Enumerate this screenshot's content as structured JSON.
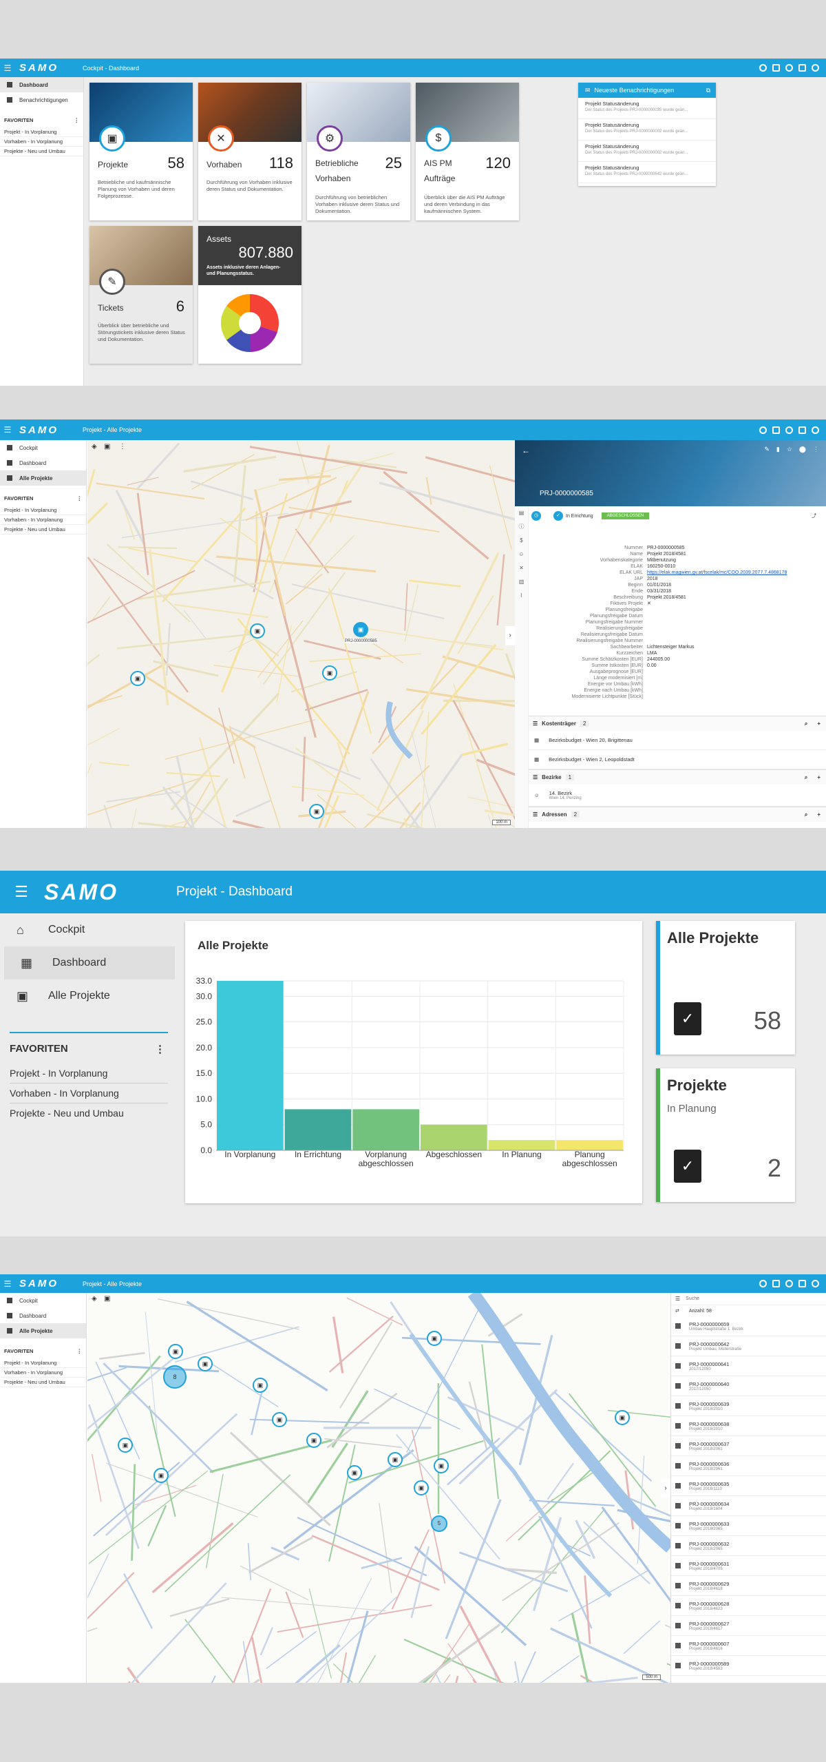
{
  "app": {
    "logo": "SAMO",
    "menu_icon": "menu-icon"
  },
  "s1": {
    "title": "Cockpit - Dashboard",
    "nav": [
      {
        "label": "Dashboard",
        "icon": "dashboard-icon"
      },
      {
        "label": "Benachrichtigungen",
        "icon": "mail-icon"
      }
    ],
    "fav_title": "FAVORITEN",
    "favs": [
      "Projekt - In Vorplanung",
      "Vorhaben - In Vorplanung",
      "Projekte - Neu und Umbau"
    ],
    "cards": [
      {
        "label": "Projekte",
        "count": "58",
        "desc": "Betriebliche und kaufmännische Planung von Vorhaben und deren Folgeprozesse.",
        "icon": "clipboard-icon",
        "color": "#1ea2dc"
      },
      {
        "label": "Vorhaben",
        "count": "118",
        "desc": "Durchführung von Vorhaben inklusive deren Status und Dokumentation.",
        "icon": "tools-icon",
        "color": "#e8591f"
      },
      {
        "label": "Betriebliche Vorhaben",
        "count": "25",
        "desc": "Durchführung von betrieblichen Vorhaben inklusive deren Status und Dokumentation.",
        "icon": "gear-clipboard-icon",
        "color": "#7b3fa0"
      },
      {
        "label": "AIS PM Aufträge",
        "count": "120",
        "desc": "Überblick über die AIS PM Aufträge und deren Verbindung in das kaufmännischen System.",
        "icon": "money-icon",
        "color": "#1ea2dc"
      },
      {
        "label": "Tickets",
        "count": "6",
        "desc": "Überblick über betriebliche und Störungstickets inklusive deren Status und Dokumentation.",
        "icon": "ticket-icon",
        "color": "#555555"
      }
    ],
    "assets": {
      "label": "Assets",
      "value": "807.880",
      "desc": "Assets inklusive deren Anlagen- und Planungsstatus."
    },
    "pie": [
      {
        "v": 30,
        "c": "#f44336"
      },
      {
        "v": 20,
        "c": "#9c27b0"
      },
      {
        "v": 15,
        "c": "#3f51b5"
      },
      {
        "v": 20,
        "c": "#cddc39"
      },
      {
        "v": 15,
        "c": "#ff9800"
      }
    ],
    "notif": {
      "title": "Neueste Benachrichtigungen",
      "items": [
        {
          "t": "Projekt Statusänderung",
          "s": "Der Status des Projekts PRJ-0000000035 wurde geän..."
        },
        {
          "t": "Projekt Statusänderung",
          "s": "Der Status des Projekts PRJ-0000000002 wurde geän..."
        },
        {
          "t": "Projekt Statusänderung",
          "s": "Der Status des Projekts PRJ-0000000002 wurde geän..."
        },
        {
          "t": "Projekt Statusänderung",
          "s": "Der Status des Projekts PRJ-0000000642 wurde geän..."
        }
      ]
    }
  },
  "s2": {
    "title": "Projekt - Alle Projekte",
    "nav": [
      {
        "label": "Cockpit",
        "icon": "home-icon"
      },
      {
        "label": "Dashboard",
        "icon": "dashboard-icon"
      },
      {
        "label": "Alle Projekte",
        "icon": "briefcase-icon"
      }
    ],
    "fav_title": "FAVORITEN",
    "favs": [
      "Projekt - In Vorplanung",
      "Vorhaben - In Vorplanung",
      "Projekte - Neu und Umbau"
    ],
    "map_pin_label": "PRJ-0000000585",
    "scale": "100 m",
    "detail": {
      "title": "PRJ-0000000585",
      "status": "In Errichtung",
      "chip": "ABGESCHLOSSEN",
      "rows": [
        {
          "k": "Nummer",
          "v": "PRJ-0000000585"
        },
        {
          "k": "Name",
          "v": "Projekt 2018/4581"
        },
        {
          "k": "Vorhabenskategorie",
          "v": "Mitbenutzung"
        },
        {
          "k": "ELAK",
          "v": "160250-0010"
        },
        {
          "k": "ELAK URL",
          "v": "https://elak.magwien.gv.at/fscelak/mc/COO.2039.2077.7.4868178"
        },
        {
          "k": "JAP",
          "v": "2018"
        },
        {
          "k": "Beginn",
          "v": "01/01/2018"
        },
        {
          "k": "Ende",
          "v": "03/31/2018"
        },
        {
          "k": "Beschreibung",
          "v": "Projekt 2018/4581"
        },
        {
          "k": "Fiktives Projekt",
          "v": "✕"
        },
        {
          "k": "Planungsfreigabe",
          "v": ""
        },
        {
          "k": "Planungsfreigabe Datum",
          "v": ""
        },
        {
          "k": "Planungsfreigabe Nummer",
          "v": ""
        },
        {
          "k": "Realisierungsfreigabe",
          "v": ""
        },
        {
          "k": "Realisierungsfreigabe Datum",
          "v": ""
        },
        {
          "k": "Realisierungsfreigabe Nummer",
          "v": ""
        },
        {
          "k": "Sachbearbeiter",
          "v": "Lichtensteiger Markus"
        },
        {
          "k": "Kurzzeichen",
          "v": "LMA"
        },
        {
          "k": "Summe Schätzkosten [EUR]",
          "v": "244005.00"
        },
        {
          "k": "Summe Istkosten [EUR]",
          "v": "0.00"
        },
        {
          "k": "Ausgabeprognose [EUR]",
          "v": ""
        },
        {
          "k": "Länge modernisiert [m]",
          "v": ""
        },
        {
          "k": "Energie vor Umbau [kWh]",
          "v": ""
        },
        {
          "k": "Energie nach Umbau [kWh]",
          "v": ""
        },
        {
          "k": "Modernisierte Lichtpunkte [Stück]",
          "v": ""
        }
      ],
      "kosten": {
        "label": "Kostenträger",
        "count": "2",
        "items": [
          "Bezirksbudget - Wien 20, Brigittenau",
          "Bezirksbudget - Wien 2, Leopoldstadt"
        ]
      },
      "bezirke": {
        "label": "Bezirke",
        "count": "1",
        "item": "14. Bezirk",
        "sub": "Wien 14, Penzing"
      },
      "adressen": {
        "label": "Adressen",
        "count": "2"
      }
    }
  },
  "s3": {
    "title": "Projekt - Dashboard",
    "nav": [
      {
        "label": "Cockpit",
        "icon": "home-icon"
      },
      {
        "label": "Dashboard",
        "icon": "dashboard-icon"
      },
      {
        "label": "Alle Projekte",
        "icon": "briefcase-icon"
      }
    ],
    "fav_title": "FAVORITEN",
    "favs": [
      "Projekt - In Vorplanung",
      "Vorhaben - In Vorplanung",
      "Projekte - Neu und Umbau"
    ],
    "kpi1": {
      "title": "Alle Projekte",
      "sub": "",
      "value": "58",
      "color": "#1ea2dc"
    },
    "kpi2": {
      "title": "Projekte",
      "sub": "In Planung",
      "value": "2",
      "color": "#4caf50"
    }
  },
  "chart_data": {
    "type": "bar",
    "title": "Alle Projekte",
    "categories": [
      "In Vorplanung",
      "In Errichtung",
      "Vorplanung abgeschlossen",
      "Abgeschlossen",
      "In Planung",
      "Planung abgeschlossen"
    ],
    "values": [
      33,
      8,
      8,
      5,
      2,
      2
    ],
    "colors": [
      "#3ec9da",
      "#3ea89a",
      "#72c27e",
      "#a9d46e",
      "#d9e46a",
      "#f3e66b"
    ],
    "yticks": [
      "0.0",
      "5.0",
      "10.0",
      "15.0",
      "20.0",
      "25.0",
      "30.0",
      "33.0"
    ],
    "ylim": [
      0,
      33
    ]
  },
  "s4": {
    "title": "Projekt - Alle Projekte",
    "nav": [
      {
        "label": "Cockpit",
        "icon": "home-icon"
      },
      {
        "label": "Dashboard",
        "icon": "dashboard-icon"
      },
      {
        "label": "Alle Projekte",
        "icon": "briefcase-icon"
      }
    ],
    "fav_title": "FAVORITEN",
    "favs": [
      "Projekt - In Vorplanung",
      "Vorhaben - In Vorplanung",
      "Projekte - Neu und Umbau"
    ],
    "search_placeholder": "Suche",
    "count_label": "Anzahl: 58",
    "scale": "500 m",
    "results": [
      {
        "t": "PRJ-0000000659",
        "s": "Umbau Hauptstraße 1. Bezirk"
      },
      {
        "t": "PRJ-0000000642",
        "s": "Projekt Umbau, Müllerstraße"
      },
      {
        "t": "PRJ-0000000641",
        "s": "2017/12050"
      },
      {
        "t": "PRJ-0000000640",
        "s": "2017/12050"
      },
      {
        "t": "PRJ-0000000639",
        "s": "Projekt 2018/2010"
      },
      {
        "t": "PRJ-0000000638",
        "s": "Projekt 2018/2010"
      },
      {
        "t": "PRJ-0000000637",
        "s": "Projekt 2018/2061"
      },
      {
        "t": "PRJ-0000000636",
        "s": "Projekt 2018/2061"
      },
      {
        "t": "PRJ-0000000635",
        "s": "Projekt 2018/1110"
      },
      {
        "t": "PRJ-0000000634",
        "s": "Projekt 2018/1604"
      },
      {
        "t": "PRJ-0000000633",
        "s": "Projekt 2018/2065"
      },
      {
        "t": "PRJ-0000000632",
        "s": "Projekt 2018/2065"
      },
      {
        "t": "PRJ-0000000631",
        "s": "Projekt 2018/4705"
      },
      {
        "t": "PRJ-0000000629",
        "s": "Projekt 2018/4618"
      },
      {
        "t": "PRJ-0000000628",
        "s": "Projekt 2018/4623"
      },
      {
        "t": "PRJ-0000000627",
        "s": "Projekt 2018/4617"
      },
      {
        "t": "PRJ-0000000607",
        "s": "Projekt 2018/4616"
      },
      {
        "t": "PRJ-0000000589",
        "s": "Projekt 2018/4583"
      }
    ],
    "cluster_labels": [
      "8",
      "5"
    ]
  }
}
